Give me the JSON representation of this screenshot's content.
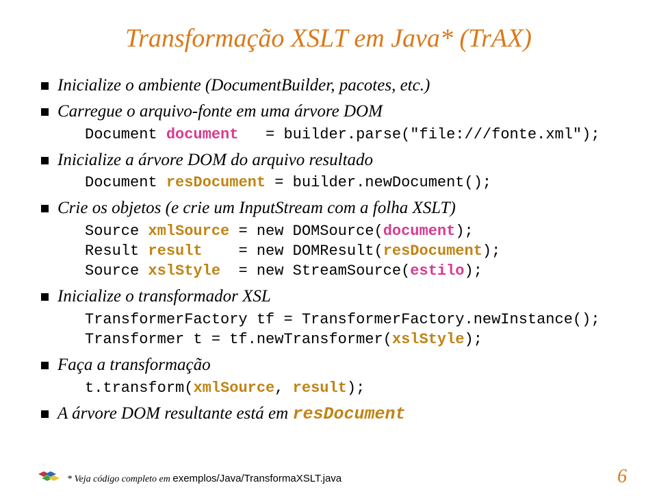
{
  "title": "Transformação XSLT em Java* (TrAX)",
  "bullets": {
    "b1": "Inicialize o ambiente (DocumentBuilder, pacotes, etc.)",
    "b2": "Carregue o arquivo-fonte em uma árvore DOM",
    "b3": "Inicialize a árvore DOM do arquivo resultado",
    "b4": "Crie os objetos (e crie um InputStream com a folha XSLT)",
    "b5": "Inicialize o transformador XSL",
    "b6": "Faça a transformação",
    "b7_prefix": "A árvore DOM resultante está em  ",
    "b7_code": "resDocument"
  },
  "code": {
    "c2_a": "Document ",
    "c2_b": "document",
    "c2_c": "   = builder.parse(\"file:///fonte.xml\");",
    "c3_a": "Document ",
    "c3_b": "resDocument",
    "c3_c": " = builder.newDocument();",
    "c4_1a": "Source ",
    "c4_1b": "xmlSource",
    "c4_1c": " = new DOMSource(",
    "c4_1d": "document",
    "c4_1e": ");",
    "c4_2a": "Result ",
    "c4_2b": "result",
    "c4_2c": "    = new DOMResult(",
    "c4_2d": "resDocument",
    "c4_2e": ");",
    "c4_3a": "Source ",
    "c4_3b": "xslStyle",
    "c4_3c": "  = new StreamSource(",
    "c4_3d": "estilo",
    "c4_3e": ");",
    "c5_1": "TransformerFactory tf = TransformerFactory.newInstance();",
    "c5_2a": "Transformer t = tf.newTransformer(",
    "c5_2b": "xslStyle",
    "c5_2c": ");",
    "c6_a": "t.transform(",
    "c6_b": "xmlSource",
    "c6_c": ", ",
    "c6_d": "result",
    "c6_e": ");"
  },
  "footnote_italic": "* Veja código completo em ",
  "footnote_regular": "exemplos/Java/TransformaXSLT.java",
  "page": "6"
}
